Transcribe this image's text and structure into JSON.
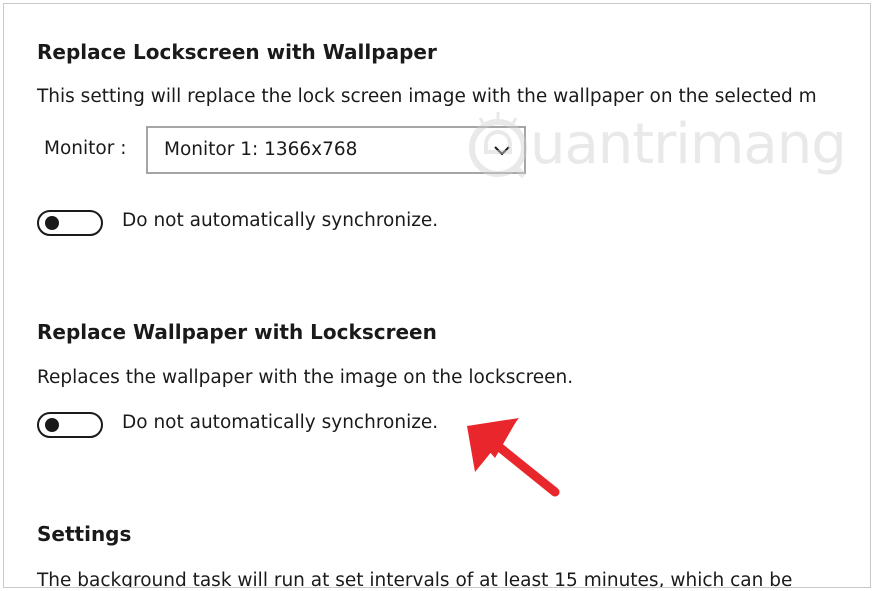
{
  "section1": {
    "heading": "Replace Lockscreen with Wallpaper",
    "description": "This setting will replace the lock screen image with the wallpaper on the selected m",
    "monitor_label": "Monitor :",
    "monitor_value": "Monitor 1: 1366x768",
    "toggle_label": "Do not automatically synchronize.",
    "toggle_on": false
  },
  "section2": {
    "heading": "Replace Wallpaper with Lockscreen",
    "description": "Replaces the wallpaper with the image on the lockscreen.",
    "toggle_label": "Do not automatically synchronize.",
    "toggle_on": false
  },
  "section3": {
    "heading": "Settings",
    "description": "The background task will run at set intervals of at least 15 minutes, which can be"
  },
  "watermark": {
    "text": "uantrimang",
    "icon": "quantrimang-logo-icon"
  },
  "annotation": {
    "icon": "red-arrow-icon",
    "color": "#e8262b"
  },
  "colors": {
    "text": "#1a1a1a",
    "border": "#a6a6a6",
    "accent_red": "#e8262b"
  }
}
